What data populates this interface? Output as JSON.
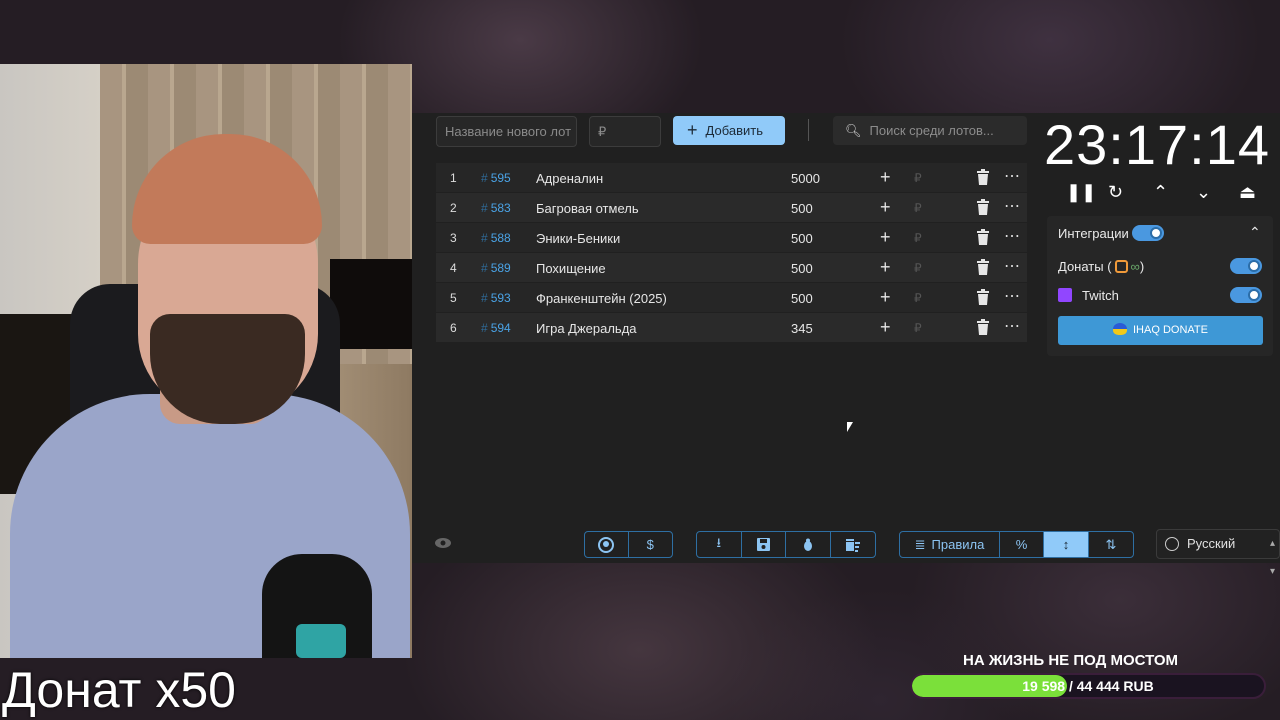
{
  "overlay": {
    "caption": "Донат x50"
  },
  "toolbar": {
    "new_lot_placeholder": "Название нового лот",
    "price_placeholder": "₽",
    "add_label": "Добавить",
    "search_placeholder": "Поиск среди лотов..."
  },
  "lots": [
    {
      "num": "1",
      "id": "595",
      "name": "Адреналин",
      "amount": "5000"
    },
    {
      "num": "2",
      "id": "583",
      "name": "Багровая отмель",
      "amount": "500"
    },
    {
      "num": "3",
      "id": "588",
      "name": "Эники-Беники",
      "amount": "500"
    },
    {
      "num": "4",
      "id": "589",
      "name": "Похищение",
      "amount": "500"
    },
    {
      "num": "5",
      "id": "593",
      "name": "Франкенштейн (2025)",
      "amount": "500"
    },
    {
      "num": "6",
      "id": "594",
      "name": "Игра Джеральда",
      "amount": "345"
    }
  ],
  "lot_currency": "₽",
  "bottom_bar": {
    "rules_label": "Правила",
    "percent_label": "%",
    "language": "Русский"
  },
  "timer": {
    "time": "23:17:14"
  },
  "integrations": {
    "title": "Интеграции",
    "donations_label": "Донаты (",
    "donations_suffix": ")",
    "twitch_label": "Twitch",
    "donate_button": "IHAQ DONATE"
  },
  "goal": {
    "title": "НА ЖИЗНЬ НЕ ПОД МОСТОМ",
    "progress": "19 598 / 44 444 RUB",
    "fraction": 0.441
  },
  "colors": {
    "accent": "#90caf9",
    "goal_fill": "#7be03a",
    "link": "#4aa3e6"
  }
}
